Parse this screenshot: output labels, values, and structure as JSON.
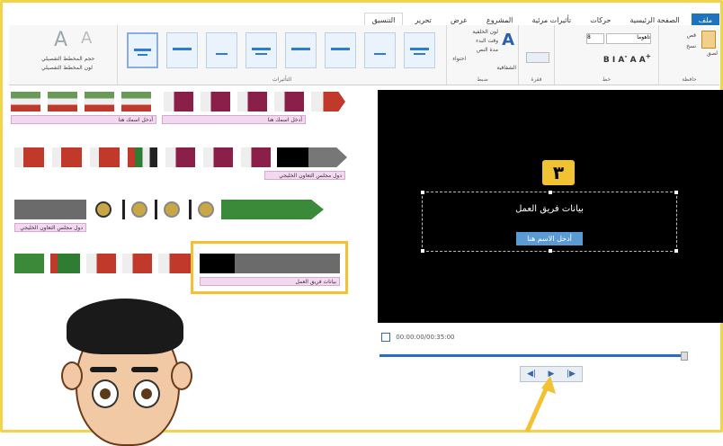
{
  "ribbon": {
    "tabs": [
      "ملف",
      "الصفحة الرئيسية",
      "حركات",
      "تأثيرات مرئية",
      "المشروع",
      "عرض",
      "تحرير",
      "التنسيق"
    ],
    "groups": [
      "حافظة",
      "خط",
      "فقرة",
      "ضبط",
      "التأثيرات"
    ],
    "clipboard": {
      "paste": "لصق",
      "cut": "قص",
      "copy": "نسخ"
    },
    "font": {
      "family": "تاهوما",
      "size": "8"
    },
    "adjust": {
      "bg_color": "لون الخلفية",
      "start_time": "وقت البدء",
      "duration": "المدة",
      "text_duration": "مدة النص"
    },
    "fit": "احتواء",
    "outline": {
      "size": "حجم المخطط التفصيلي",
      "color": "لون المخطط التفصيلي"
    },
    "text_transparency": "الشفافية"
  },
  "story": {
    "labels": [
      "أدخل اسمك هنا",
      "أدخل اسمك هنا",
      "دول مجلس التعاون الخليجي",
      "دول مجلس التعاون الخليجي",
      "بيانات فريق العمل"
    ]
  },
  "preview": {
    "badge": "٣",
    "title": "بيانات فريق العمل",
    "subtitle": "أدخل الاسم هنا",
    "time": "00:00:00/00:35:00"
  },
  "colors": {
    "highlight": "#f2c233",
    "accent": "#1e73be",
    "label_pink": "#f3d9ef"
  }
}
